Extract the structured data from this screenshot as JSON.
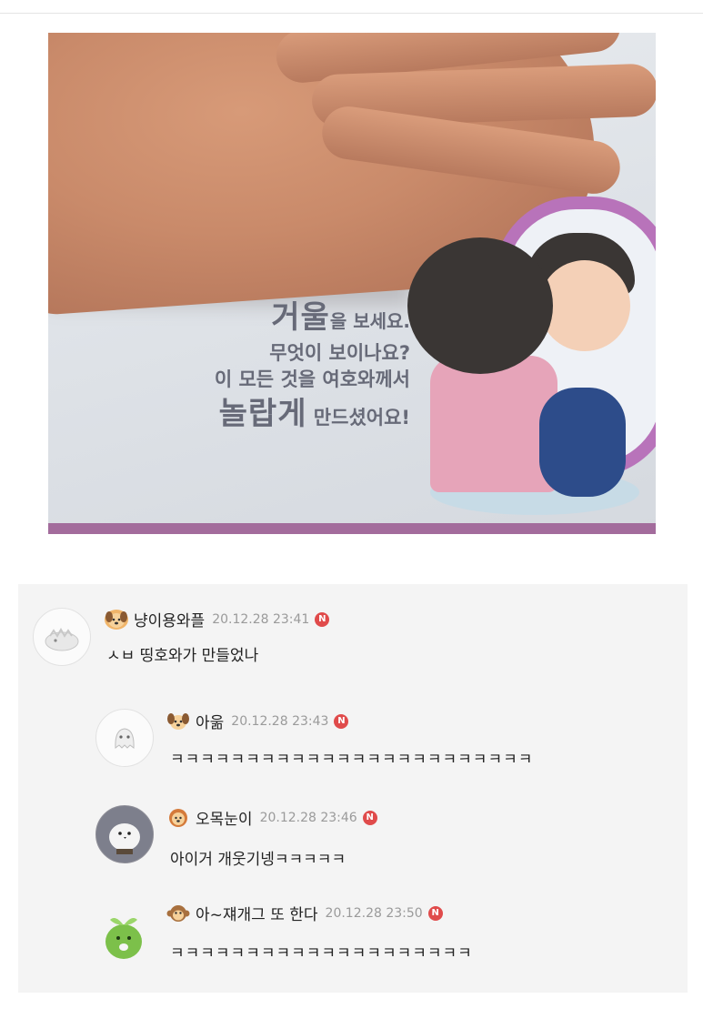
{
  "photo": {
    "caption_lines": [
      "거울을 보세요.",
      "무엇이 보이나요?",
      "이 모든 것을 여호와께서",
      "놀랍게 만드셨어요!"
    ],
    "caption_emphasis": [
      "거울",
      "놀랍게"
    ]
  },
  "comments": [
    {
      "nickname": "냥이용와플",
      "date": "20.12.28 23:41",
      "text": "ㅅㅂ 띵호와가 만들었나",
      "new_badge": "N",
      "level_icon": "puppy-face-icon",
      "avatar_icon": "white-dinosaur-icon",
      "reply": false
    },
    {
      "nickname": "아욺",
      "date": "20.12.28 23:43",
      "text": "ㅋㅋㅋㅋㅋㅋㅋㅋㅋㅋㅋㅋㅋㅋㅋㅋㅋㅋㅋㅋㅋㅋㅋㅋ",
      "new_badge": "N",
      "level_icon": "puppy-face-icon",
      "avatar_icon": "white-ghost-icon",
      "reply": true
    },
    {
      "nickname": "오목눈이",
      "date": "20.12.28 23:46",
      "text": "아이거 개웃기넹ㅋㅋㅋㅋㅋ",
      "new_badge": "N",
      "level_icon": "lion-face-icon",
      "avatar_icon": "white-bird-photo",
      "reply": true
    },
    {
      "nickname": "아~쟤개그 또 한다",
      "date": "20.12.28 23:50",
      "text": "ㅋㅋㅋㅋㅋㅋㅋㅋㅋㅋㅋㅋㅋㅋㅋㅋㅋㅋㅋㅋ",
      "new_badge": "N",
      "level_icon": "monkey-face-icon",
      "avatar_icon": "green-sprout-character-icon",
      "reply": true
    }
  ],
  "colors": {
    "new_badge": "#e04b4b",
    "comment_bg": "#f4f4f4",
    "date_text": "#9a9a9a"
  }
}
